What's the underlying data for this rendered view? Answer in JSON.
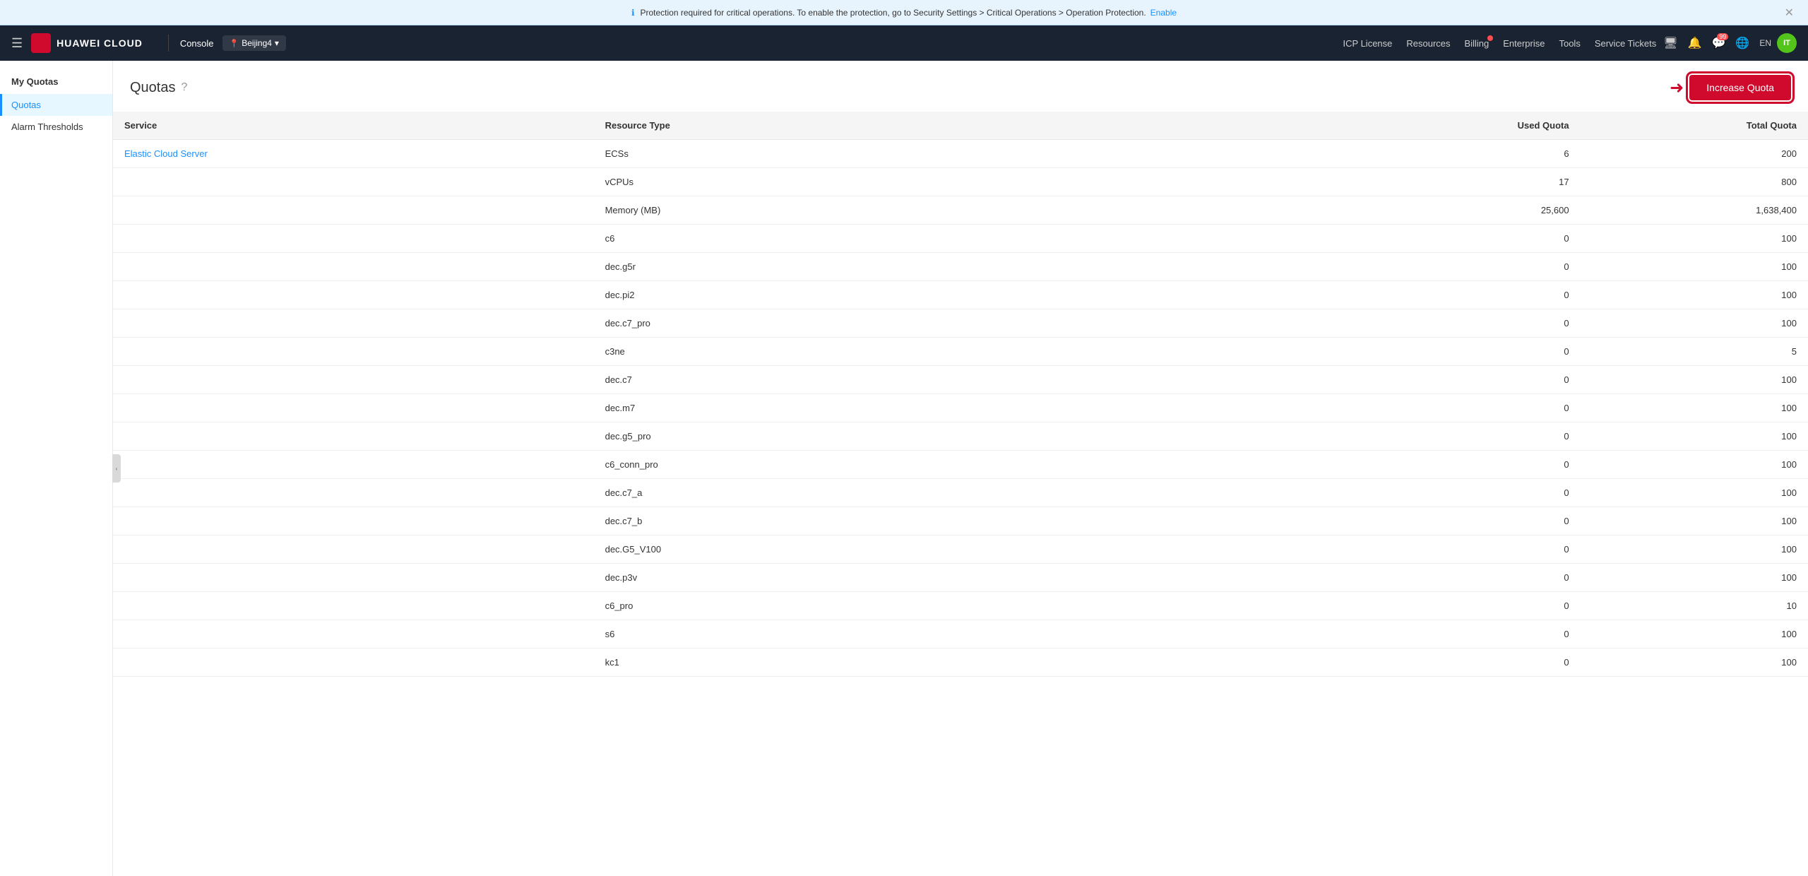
{
  "notification": {
    "message": "Protection required for critical operations. To enable the protection, go to Security Settings > Critical Operations > Operation Protection.",
    "enable_text": "Enable"
  },
  "navbar": {
    "brand": "HUAWEI CLOUD",
    "console": "Console",
    "region": "Beijing4",
    "links": [
      "ICP License",
      "Resources",
      "Billing",
      "Enterprise",
      "Tools",
      "Service Tickets"
    ],
    "lang": "EN"
  },
  "sidebar": {
    "section": "My Quotas",
    "items": [
      {
        "label": "Quotas",
        "active": true
      },
      {
        "label": "Alarm Thresholds",
        "active": false
      }
    ]
  },
  "page": {
    "title": "Quotas",
    "increase_quota_btn": "Increase Quota"
  },
  "table": {
    "columns": [
      "Service",
      "Resource Type",
      "Used Quota",
      "Total Quota"
    ],
    "rows": [
      {
        "service": "Elastic Cloud Server",
        "resource": "ECSs",
        "used": "6",
        "total": "200"
      },
      {
        "service": "",
        "resource": "vCPUs",
        "used": "17",
        "total": "800"
      },
      {
        "service": "",
        "resource": "Memory (MB)",
        "used": "25,600",
        "total": "1,638,400"
      },
      {
        "service": "",
        "resource": "c6",
        "used": "0",
        "total": "100"
      },
      {
        "service": "",
        "resource": "dec.g5r",
        "used": "0",
        "total": "100"
      },
      {
        "service": "",
        "resource": "dec.pi2",
        "used": "0",
        "total": "100"
      },
      {
        "service": "",
        "resource": "dec.c7_pro",
        "used": "0",
        "total": "100"
      },
      {
        "service": "",
        "resource": "c3ne",
        "used": "0",
        "total": "5"
      },
      {
        "service": "",
        "resource": "dec.c7",
        "used": "0",
        "total": "100"
      },
      {
        "service": "",
        "resource": "dec.m7",
        "used": "0",
        "total": "100"
      },
      {
        "service": "",
        "resource": "dec.g5_pro",
        "used": "0",
        "total": "100"
      },
      {
        "service": "",
        "resource": "c6_conn_pro",
        "used": "0",
        "total": "100"
      },
      {
        "service": "",
        "resource": "dec.c7_a",
        "used": "0",
        "total": "100"
      },
      {
        "service": "",
        "resource": "dec.c7_b",
        "used": "0",
        "total": "100"
      },
      {
        "service": "",
        "resource": "dec.G5_V100",
        "used": "0",
        "total": "100"
      },
      {
        "service": "",
        "resource": "dec.p3v",
        "used": "0",
        "total": "100"
      },
      {
        "service": "",
        "resource": "c6_pro",
        "used": "0",
        "total": "10"
      },
      {
        "service": "",
        "resource": "s6",
        "used": "0",
        "total": "100"
      },
      {
        "service": "",
        "resource": "kc1",
        "used": "0",
        "total": "100"
      }
    ]
  }
}
